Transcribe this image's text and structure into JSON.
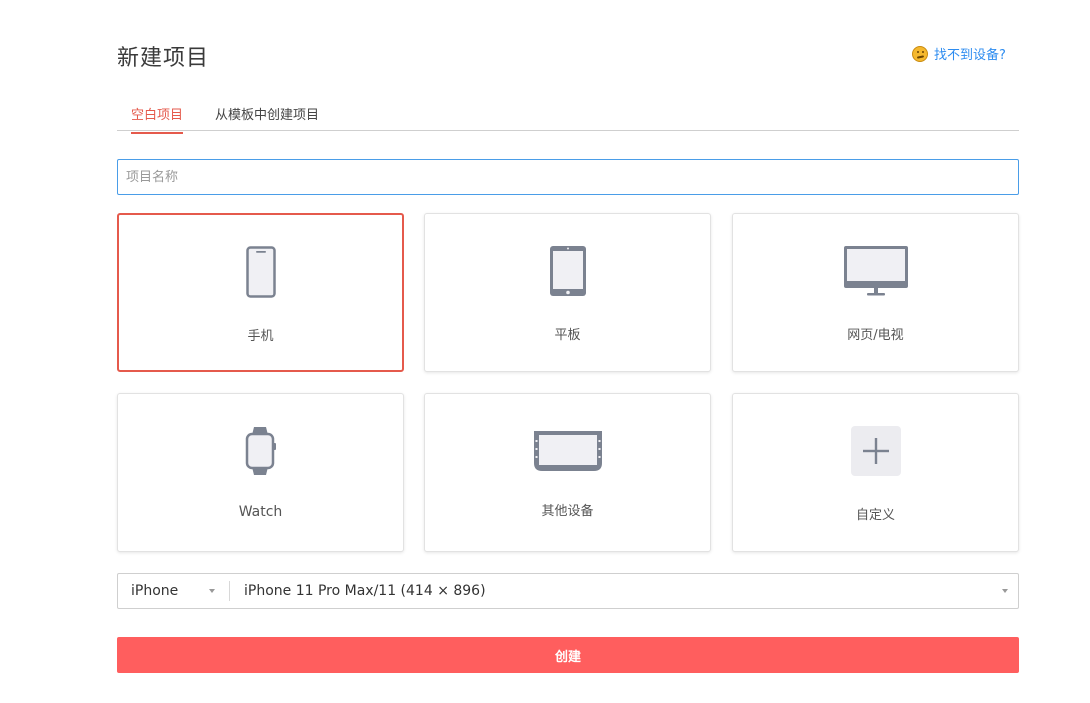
{
  "header": {
    "title": "新建项目",
    "help_label": "找不到设备?"
  },
  "tabs": [
    {
      "label": "空白项目",
      "active": true
    },
    {
      "label": "从模板中创建项目",
      "active": false
    }
  ],
  "project_name": {
    "placeholder": "项目名称",
    "value": ""
  },
  "devices": [
    {
      "label": "手机",
      "icon": "phone-icon",
      "selected": true
    },
    {
      "label": "平板",
      "icon": "tablet-icon",
      "selected": false
    },
    {
      "label": "网页/电视",
      "icon": "monitor-icon",
      "selected": false
    },
    {
      "label": "Watch",
      "icon": "watch-icon",
      "selected": false
    },
    {
      "label": "其他设备",
      "icon": "other-device-icon",
      "selected": false
    },
    {
      "label": "自定义",
      "icon": "plus-icon",
      "selected": false
    }
  ],
  "device_select": {
    "type_value": "iPhone",
    "model_value": "iPhone 11 Pro Max/11 (414 × 896)"
  },
  "create_button": {
    "label": "创建"
  },
  "colors": {
    "accent": "#e55a4c",
    "link": "#2d8cf0",
    "button": "#ff5e5e",
    "icon": "#7b8290",
    "focus": "#4a9de8"
  }
}
